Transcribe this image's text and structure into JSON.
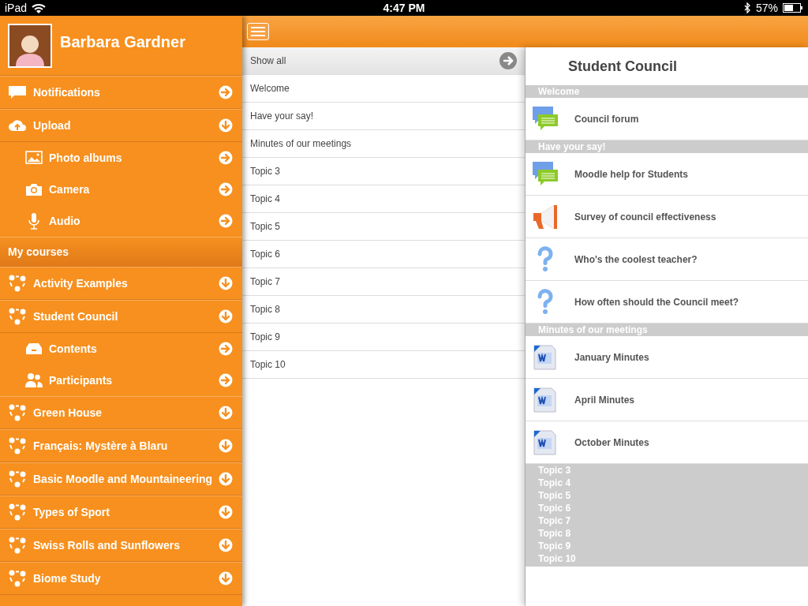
{
  "status_bar": {
    "device": "iPad",
    "time": "4:47 PM",
    "battery": "57%"
  },
  "sidebar": {
    "user": {
      "name": "Barbara Gardner"
    },
    "items": [
      {
        "kind": "item",
        "label": "Notifications",
        "expandable": false
      },
      {
        "kind": "item",
        "label": "Upload",
        "expandable": true
      },
      {
        "kind": "subitem",
        "label": "Photo albums",
        "expandable": false
      },
      {
        "kind": "subitem",
        "label": "Camera",
        "expandable": false
      },
      {
        "kind": "subitem",
        "label": "Audio",
        "expandable": false
      },
      {
        "kind": "header",
        "label": "My courses"
      },
      {
        "kind": "course",
        "label": "Activity Examples",
        "expandable": true
      },
      {
        "kind": "course",
        "label": "Student Council",
        "expandable": true
      },
      {
        "kind": "subitem",
        "label": "Contents",
        "expandable": false
      },
      {
        "kind": "subitem",
        "label": "Participants",
        "expandable": false
      },
      {
        "kind": "course",
        "label": "Green House",
        "expandable": true
      },
      {
        "kind": "course",
        "label": "Français: Mystère à Blaru",
        "expandable": true
      },
      {
        "kind": "course",
        "label": "Basic Moodle and Mountaineering",
        "expandable": true
      },
      {
        "kind": "course",
        "label": "Types of Sport",
        "expandable": true
      },
      {
        "kind": "course",
        "label": "Swiss Rolls and Sunflowers",
        "expandable": true
      },
      {
        "kind": "course",
        "label": "Biome Study",
        "expandable": true
      }
    ]
  },
  "topics": [
    {
      "label": "Show all",
      "selected": true
    },
    {
      "label": "Welcome",
      "selected": false
    },
    {
      "label": "Have your say!",
      "selected": false
    },
    {
      "label": "Minutes of our meetings",
      "selected": false
    },
    {
      "label": "Topic 3",
      "selected": false
    },
    {
      "label": "Topic 4",
      "selected": false
    },
    {
      "label": "Topic 5",
      "selected": false
    },
    {
      "label": "Topic 6",
      "selected": false
    },
    {
      "label": "Topic 7",
      "selected": false
    },
    {
      "label": "Topic 8",
      "selected": false
    },
    {
      "label": "Topic 9",
      "selected": false
    },
    {
      "label": "Topic 10",
      "selected": false
    }
  ],
  "course": {
    "title": "Student Council",
    "sections": [
      {
        "title": "Welcome",
        "items": [
          {
            "kind": "forum",
            "label": "Council forum"
          }
        ]
      },
      {
        "title": "Have your say!",
        "items": [
          {
            "kind": "forum",
            "label": "Moodle help for Students"
          },
          {
            "kind": "survey",
            "label": "Survey of council effectiveness"
          },
          {
            "kind": "question",
            "label": "Who's the coolest teacher?"
          },
          {
            "kind": "question",
            "label": "How often should the Council meet?"
          }
        ]
      },
      {
        "title": "Minutes of our meetings",
        "items": [
          {
            "kind": "word",
            "label": "January Minutes"
          },
          {
            "kind": "word",
            "label": "April Minutes"
          },
          {
            "kind": "word",
            "label": "October Minutes"
          }
        ]
      },
      {
        "title": "Topic 3"
      },
      {
        "title": "Topic 4"
      },
      {
        "title": "Topic 5"
      },
      {
        "title": "Topic 6"
      },
      {
        "title": "Topic 7"
      },
      {
        "title": "Topic 8"
      },
      {
        "title": "Topic 9"
      },
      {
        "title": "Topic 10"
      }
    ]
  }
}
